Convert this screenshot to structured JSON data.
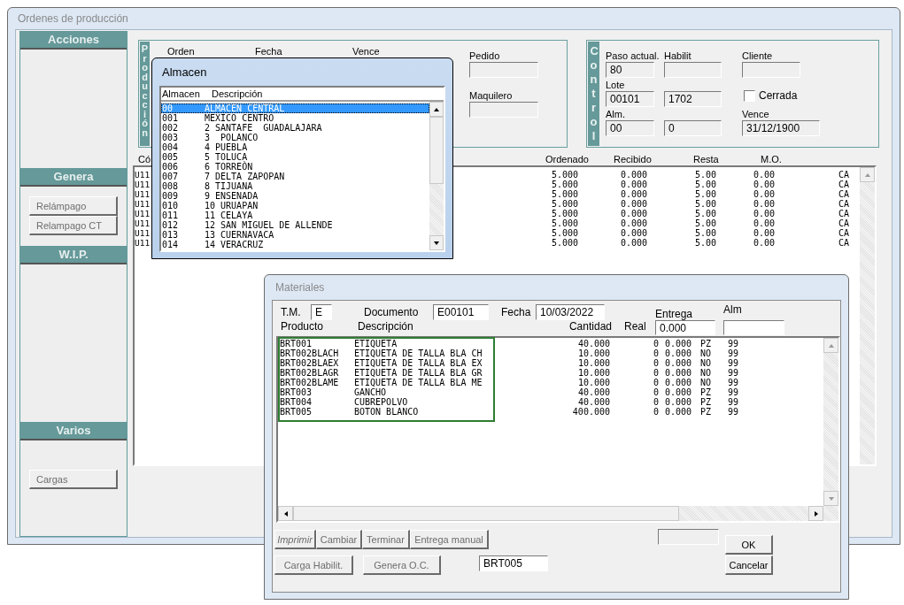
{
  "main_window": {
    "title": "Ordenes de producción",
    "active": false,
    "sidebar": [
      {
        "header": "Acciones"
      },
      {
        "header": "Genera",
        "buttons": [
          {
            "label": "Relámpago",
            "disabled": true
          },
          {
            "label": "Relampago CT",
            "disabled": true
          }
        ]
      },
      {
        "header": "W.I.P."
      },
      {
        "header": "Varios",
        "buttons": [
          {
            "label": "Cargas",
            "disabled": true
          }
        ]
      }
    ],
    "produccion": {
      "caption": "Producción",
      "labels": [
        "Orden",
        "Fecha",
        "Vence"
      ],
      "fields": [
        {
          "label": "Pedido"
        },
        {
          "label": "Maquilero"
        }
      ]
    },
    "control": {
      "caption": "Control",
      "items": [
        {
          "kind": "field",
          "label": "Paso actual.",
          "value": "80"
        },
        {
          "kind": "field",
          "label": "Habilit"
        },
        {
          "kind": "field",
          "label": "Cliente"
        },
        {
          "kind": "field",
          "label": "Lote",
          "value": "00101"
        },
        {
          "kind": "field",
          "value": "1702"
        },
        {
          "kind": "checkbox",
          "label": "Cerrada",
          "checked": false
        },
        {
          "kind": "field",
          "label": "Alm.",
          "value": "00"
        },
        {
          "kind": "field",
          "value": "0"
        },
        {
          "kind": "field",
          "label": "Vence",
          "value": "31/12/1900",
          "wide": true
        }
      ]
    },
    "table": {
      "columns": [
        "Có",
        "Ordenado",
        "Recibido",
        "Resta",
        "M.O."
      ],
      "rows": [
        {
          "cells": [
            "U11",
            "5.000",
            "0.000",
            "5.00",
            "0.00",
            "CA"
          ]
        },
        {
          "cells": [
            "U11",
            "5.000",
            "0.000",
            "5.00",
            "0.00",
            "CA"
          ]
        },
        {
          "cells": [
            "U11",
            "5.000",
            "0.000",
            "5.00",
            "0.00",
            "CA"
          ]
        },
        {
          "cells": [
            "U11",
            "5.000",
            "0.000",
            "5.00",
            "0.00",
            "CA"
          ]
        },
        {
          "cells": [
            "U11",
            "5.000",
            "0.000",
            "5.00",
            "0.00",
            "CA"
          ]
        },
        {
          "cells": [
            "U11",
            "5.000",
            "0.000",
            "5.00",
            "0.00",
            "CA"
          ]
        },
        {
          "cells": [
            "U11",
            "5.000",
            "0.000",
            "5.00",
            "0.00",
            "CA"
          ]
        },
        {
          "cells": [
            "U11",
            "5.000",
            "0.000",
            "5.00",
            "0.00",
            "CA"
          ]
        }
      ]
    }
  },
  "almacen_dialog": {
    "title": "Almacen",
    "active": true,
    "columns": [
      "Almacen",
      "Descripción"
    ],
    "rows": [
      {
        "code": "00",
        "name": "ALMACEN CENTRAL",
        "selected": true
      },
      {
        "code": "001",
        "name": "MEXICO CENTRO",
        "selected": false
      },
      {
        "code": "002",
        "name": "2 SANTAFE  GUADALAJARA",
        "selected": false
      },
      {
        "code": "003",
        "name": "3  POLANCO",
        "selected": false
      },
      {
        "code": "004",
        "name": "4 PUEBLA",
        "selected": false
      },
      {
        "code": "005",
        "name": "5 TOLUCA",
        "selected": false
      },
      {
        "code": "006",
        "name": "6 TORREÒN",
        "selected": false
      },
      {
        "code": "007",
        "name": "7 DELTA ZAPOPAN",
        "selected": false
      },
      {
        "code": "008",
        "name": "8 TIJUANA",
        "selected": false
      },
      {
        "code": "009",
        "name": "9 ENSENADA",
        "selected": false
      },
      {
        "code": "010",
        "name": "10 URUAPAN",
        "selected": false
      },
      {
        "code": "011",
        "name": "11 CELAYA",
        "selected": false
      },
      {
        "code": "012",
        "name": "12 SAN MIGUEL DE ALLENDE",
        "selected": false
      },
      {
        "code": "013",
        "name": "13 CUERNAVACA",
        "selected": false
      },
      {
        "code": "014",
        "name": "14 VERACRUZ",
        "selected": false
      }
    ]
  },
  "materiales_dialog": {
    "title": "Materiales",
    "active": false,
    "tm": {
      "label": "T.M.",
      "value": "E"
    },
    "documento": {
      "label": "Documento",
      "value": "E00101"
    },
    "fecha": {
      "label": "Fecha",
      "value": "10/03/2022"
    },
    "entrega": {
      "label": "Entrega",
      "value": "0.000"
    },
    "alm": {
      "label": "Alm"
    },
    "columns": [
      "Producto",
      "Descripción",
      "Cantidad",
      "Real"
    ],
    "rows": [
      {
        "cells": [
          "BRT001",
          "ETIQUETA",
          "40.000",
          "0",
          "0.000",
          "PZ",
          "99"
        ]
      },
      {
        "cells": [
          "BRT002BLACH",
          "ETIQUETA DE TALLA BLA CH",
          "10.000",
          "0",
          "0.000",
          "NO",
          "99"
        ]
      },
      {
        "cells": [
          "BRT002BLAEX",
          "ETIQUETA DE TALLA BLA EX",
          "10.000",
          "0",
          "0.000",
          "NO",
          "99"
        ]
      },
      {
        "cells": [
          "BRT002BLAGR",
          "ETIQUETA DE TALLA BLA GR",
          "10.000",
          "0",
          "0.000",
          "NO",
          "99"
        ]
      },
      {
        "cells": [
          "BRT002BLAME",
          "ETIQUETA DE TALLA BLA ME",
          "10.000",
          "0",
          "0.000",
          "NO",
          "99"
        ]
      },
      {
        "cells": [
          "BRT003",
          "GANCHO",
          "40.000",
          "0",
          "0.000",
          "PZ",
          "99"
        ]
      },
      {
        "cells": [
          "BRT004",
          "CUBREPOLVO",
          "40.000",
          "0",
          "0.000",
          "PZ",
          "99"
        ]
      },
      {
        "cells": [
          "BRT005",
          "BOTON BLANCO",
          "400.000",
          "0",
          "0.000",
          "PZ",
          "99"
        ]
      }
    ],
    "action_buttons": [
      {
        "label": "Imprimir",
        "disabled": true,
        "italic": true
      },
      {
        "label": "Cambiar",
        "disabled": true
      },
      {
        "label": "Terminar",
        "disabled": true
      },
      {
        "label": "Entrega manual",
        "disabled": true
      }
    ],
    "lower_buttons": [
      {
        "label": "Carga Habilit.",
        "disabled": true
      },
      {
        "label": "Genera O.C.",
        "disabled": true
      }
    ],
    "search_value": "BRT005",
    "ok": {
      "label": "OK",
      "disabled": false
    },
    "cancel": {
      "label": "Cancelar",
      "disabled": false
    }
  }
}
